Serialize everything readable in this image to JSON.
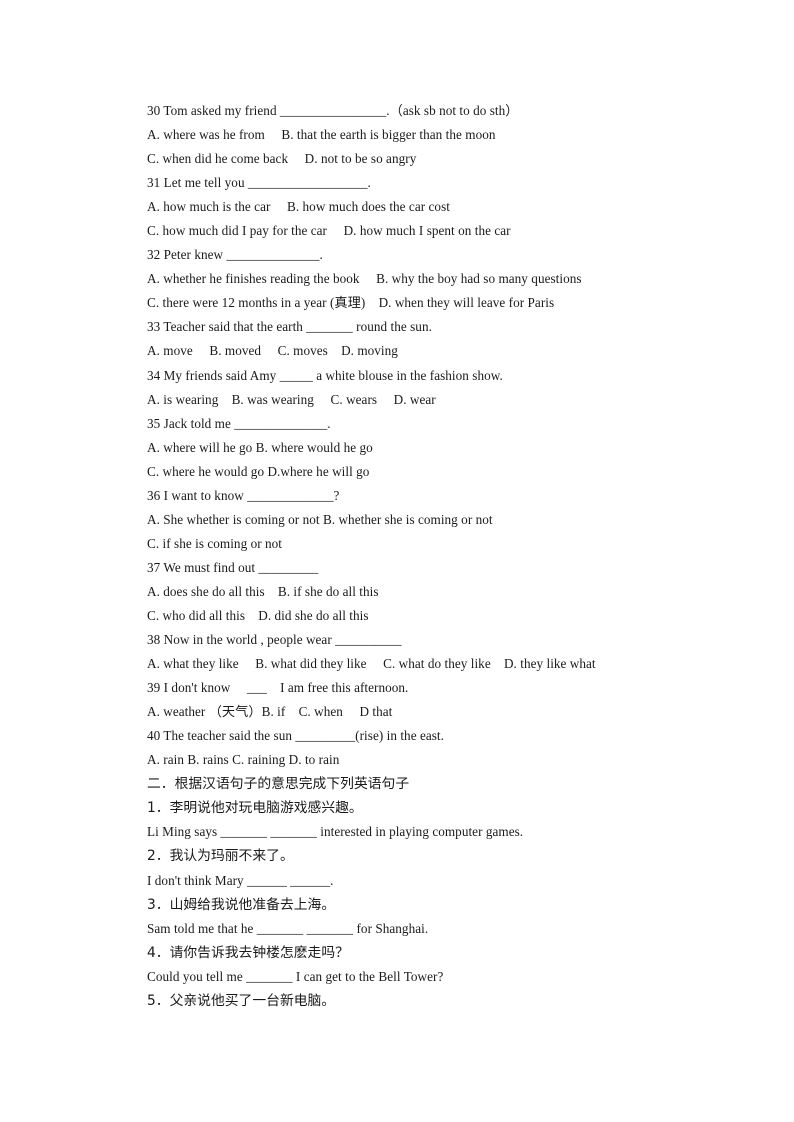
{
  "document": {
    "background_color": "#ffffff",
    "text_color": "#1a1a1a",
    "lines": [
      {
        "id": "q30-stem",
        "kind": "en",
        "text": "30 Tom asked my friend ________________.（ask sb not to do sth）"
      },
      {
        "id": "q30-opt-ab",
        "kind": "en",
        "text": "A. where was he from　 B. that the earth is bigger than the moon"
      },
      {
        "id": "q30-opt-cd",
        "kind": "en",
        "text": "C. when did he come back　 D. not to be so angry"
      },
      {
        "id": "q31-stem",
        "kind": "en",
        "text": "31 Let me tell you __________________."
      },
      {
        "id": "q31-opt-ab",
        "kind": "en",
        "text": "A. how much is the car　 B. how much does the car cost"
      },
      {
        "id": "q31-opt-cd",
        "kind": "en",
        "text": "C. how much did I pay for the car　 D. how much I spent on the car"
      },
      {
        "id": "q32-stem",
        "kind": "en",
        "text": "32 Peter knew ______________."
      },
      {
        "id": "q32-opt-ab",
        "kind": "en",
        "text": "A. whether he finishes reading the book　 B. why the boy had so many questions"
      },
      {
        "id": "q32-opt-cd",
        "kind": "en",
        "text": "C. there were 12 months in a year (真理)　D. when they will leave for Paris"
      },
      {
        "id": "q33-stem",
        "kind": "en",
        "text": "33 Teacher said that the earth _______ round the sun."
      },
      {
        "id": "q33-opt",
        "kind": "en",
        "text": "A. move　 B. moved　 C. moves　D. moving"
      },
      {
        "id": "q34-stem",
        "kind": "en",
        "text": "34 My friends said Amy _____ a white blouse in the fashion show."
      },
      {
        "id": "q34-opt",
        "kind": "en",
        "text": "A. is wearing　B. was wearing　 C. wears　 D. wear"
      },
      {
        "id": "q35-stem",
        "kind": "en",
        "text": "35 Jack told me ______________."
      },
      {
        "id": "q35-opt-ab",
        "kind": "en",
        "text": "A. where will he go B. where would he go"
      },
      {
        "id": "q35-opt-cd",
        "kind": "en",
        "text": "C. where he would go D.where he will go"
      },
      {
        "id": "q36-stem",
        "kind": "en",
        "text": "36 I want to know _____________?"
      },
      {
        "id": "q36-opt-ab",
        "kind": "en",
        "text": "A. She whether is coming or not B. whether she is coming or not"
      },
      {
        "id": "q36-opt-c",
        "kind": "en",
        "text": "C. if she is coming or not"
      },
      {
        "id": "q37-stem",
        "kind": "en",
        "text": "37 We must find out _________"
      },
      {
        "id": "q37-opt-ab",
        "kind": "en",
        "text": "A. does she do all this　B. if she do all this"
      },
      {
        "id": "q37-opt-cd",
        "kind": "en",
        "text": "C. who did all this　D. did she do all this"
      },
      {
        "id": "q38-stem",
        "kind": "en",
        "text": "38 Now in the world , people wear __________"
      },
      {
        "id": "q38-opt",
        "kind": "en",
        "text": "A. what they like　 B. what did they like　 C. what do they like　D. they like what"
      },
      {
        "id": "q39-stem",
        "kind": "en",
        "text": "39 I don't know　 ___　I am free this afternoon."
      },
      {
        "id": "q39-opt",
        "kind": "en",
        "text": "A. weather （天气）B. if　C. when　 D that"
      },
      {
        "id": "q40-stem",
        "kind": "en",
        "text": "40 The teacher said the sun _________(rise) in the east."
      },
      {
        "id": "q40-opt",
        "kind": "en",
        "text": "A. rain B. rains C. raining D. to rain"
      },
      {
        "id": "section2-head",
        "kind": "cjk-head",
        "text": "二．根据汉语句子的意思完成下列英语句子"
      },
      {
        "id": "t1-cn",
        "kind": "cjk",
        "text": "1．李明说他对玩电脑游戏感兴趣。"
      },
      {
        "id": "t1-en",
        "kind": "en",
        "text": "Li Ming says _______ _______ interested in playing computer games."
      },
      {
        "id": "t2-cn",
        "kind": "cjk",
        "text": "2．我认为玛丽不来了。"
      },
      {
        "id": "t2-en",
        "kind": "en",
        "text": "I don't think Mary ______ ______."
      },
      {
        "id": "t3-cn",
        "kind": "cjk",
        "text": "3．山姆给我说他准备去上海。"
      },
      {
        "id": "t3-en",
        "kind": "en",
        "text": "Sam told me that he _______ _______ for Shanghai."
      },
      {
        "id": "t4-cn",
        "kind": "cjk",
        "text": "4．请你告诉我去钟楼怎麽走吗？"
      },
      {
        "id": "t4-en",
        "kind": "en",
        "text": "Could you tell me _______ I can get to the Bell Tower?"
      },
      {
        "id": "t5-cn",
        "kind": "cjk",
        "text": "5．父亲说他买了一台新电脑。"
      }
    ]
  }
}
